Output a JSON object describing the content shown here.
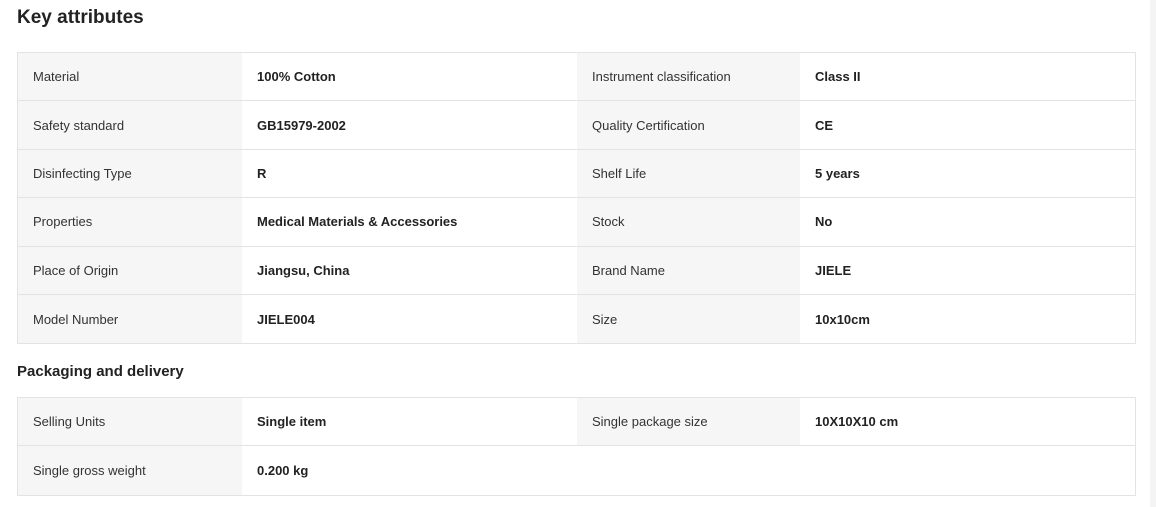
{
  "key_attributes": {
    "title": "Key attributes",
    "rows": [
      {
        "l1": "Material",
        "v1": "100% Cotton",
        "l2": "Instrument classification",
        "v2": "Class II"
      },
      {
        "l1": "Safety standard",
        "v1": "GB15979-2002",
        "l2": "Quality Certification",
        "v2": "CE"
      },
      {
        "l1": "Disinfecting Type",
        "v1": "R",
        "l2": "Shelf Life",
        "v2": "5 years"
      },
      {
        "l1": "Properties",
        "v1": "Medical Materials & Accessories",
        "l2": "Stock",
        "v2": "No"
      },
      {
        "l1": "Place of Origin",
        "v1": "Jiangsu, China",
        "l2": "Brand Name",
        "v2": "JIELE"
      },
      {
        "l1": "Model Number",
        "v1": "JIELE004",
        "l2": "Size",
        "v2": "10x10cm"
      }
    ]
  },
  "packaging": {
    "title": "Packaging and delivery",
    "rows": [
      {
        "l1": "Selling Units",
        "v1": "Single item",
        "l2": "Single package size",
        "v2": "10X10X10 cm"
      },
      {
        "l1": "Single gross weight",
        "v1": "0.200 kg",
        "l2": "",
        "v2": ""
      }
    ]
  }
}
